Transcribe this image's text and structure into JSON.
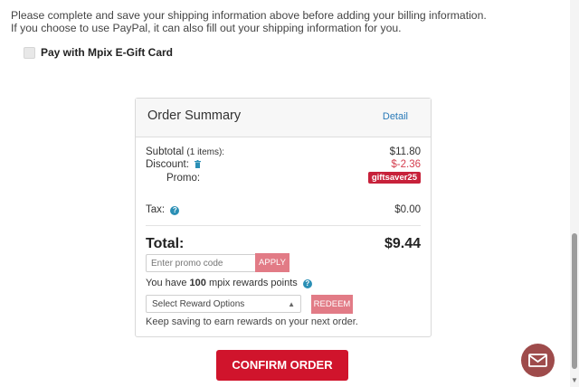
{
  "notice": {
    "line1": "Please complete and save your shipping information above before adding your billing information.",
    "line2": "If you choose to use PayPal, it can also fill out your shipping information for you."
  },
  "gift_card": {
    "label": "Pay with Mpix E-Gift Card",
    "checked": false
  },
  "summary": {
    "title": "Order Summary",
    "detail_link": "Detail",
    "subtotal_label": "Subtotal",
    "subtotal_items": "(1 items):",
    "subtotal_value": "$11.80",
    "discount_label": "Discount:",
    "discount_value": "$-2.36",
    "promo_label": "Promo:",
    "promo_code": "giftsaver25",
    "tax_label": "Tax:",
    "tax_value": "$0.00",
    "total_label": "Total:",
    "total_value": "$9.44",
    "promo_placeholder": "Enter promo code",
    "apply_label": "APPLY",
    "rewards_prefix": "You have",
    "rewards_points": "100",
    "rewards_suffix": "mpix rewards points",
    "reward_select": "Select Reward Options",
    "redeem_label": "REDEEM",
    "keep_saving": "Keep saving to earn rewards on your next order."
  },
  "confirm_label": "CONFIRM ORDER",
  "icons": {
    "trash": "trash-icon",
    "help": "help-icon",
    "mail": "mail-icon"
  },
  "colors": {
    "accent": "#d0142c",
    "muted_button": "#e27b86",
    "link": "#2a7ab8",
    "chat": "#9e4b4b"
  }
}
